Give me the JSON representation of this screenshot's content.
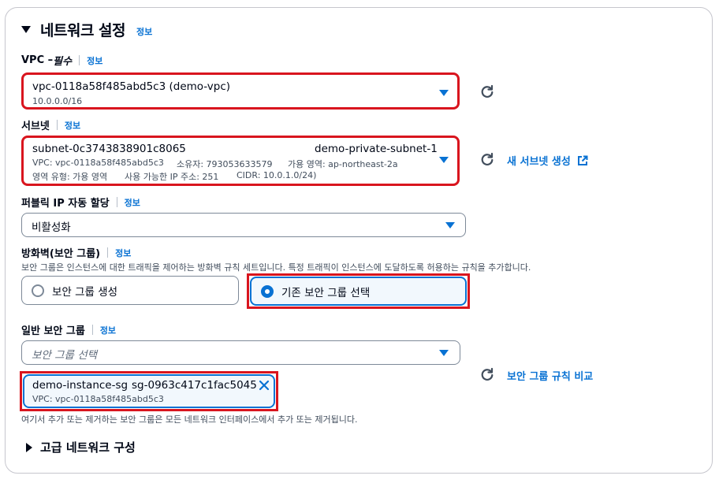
{
  "section": {
    "title": "네트워크 설정",
    "info": "정보"
  },
  "vpc": {
    "label": "VPC – ",
    "label_suffix": "필수",
    "info": "정보",
    "value": "vpc-0118a58f485abd5c3 (demo-vpc)",
    "cidr": "10.0.0.0/16"
  },
  "subnet": {
    "label": "서브넷",
    "info": "정보",
    "id": "subnet-0c3743838901c8065",
    "name": "demo-private-subnet-1",
    "line2_vpc": "VPC: vpc-0118a58f485abd5c3",
    "line2_owner": "소유자: 793053633579",
    "line2_az": "가용 영역: ap-northeast-2a",
    "line3_type": "영역 유형: 가용 영역",
    "line3_ips": "사용 가능한 IP 주소: 251",
    "line3_cidr": "CIDR: 10.0.1.0/24)",
    "create_link": "새 서브넷 생성"
  },
  "public_ip": {
    "label": "퍼블릭 IP 자동 할당",
    "info": "정보",
    "value": "비활성화"
  },
  "firewall": {
    "label": "방화벽(보안 그룹)",
    "info": "정보",
    "description": "보안 그룹은 인스턴스에 대한 트래픽을 제어하는 방화벽 규칙 세트입니다. 특정 트래픽이 인스턴스에 도달하도록 허용하는 규칙을 추가합니다.",
    "option_create": "보안 그룹 생성",
    "option_existing": "기존 보안 그룹 선택",
    "selected": "기존 보안 그룹 선택"
  },
  "common_sg": {
    "label": "일반 보안 그룹",
    "info": "정보",
    "placeholder": "보안 그룹 선택",
    "compare_link": "보안 그룹 규칙 비교",
    "token_name": "demo-instance-sg",
    "token_id": "sg-0963c417c1fac5045",
    "token_vpc": "VPC: vpc-0118a58f485abd5c3",
    "note": "여기서 추가 또는 제거하는 보안 그룹은 모든 네트워크 인터페이스에서 추가 또는 제거됩니다."
  },
  "advanced": {
    "title": "고급 네트워크 구성"
  },
  "colors": {
    "accent": "#0972d3",
    "highlight": "#d9151e",
    "text": "#000716"
  }
}
